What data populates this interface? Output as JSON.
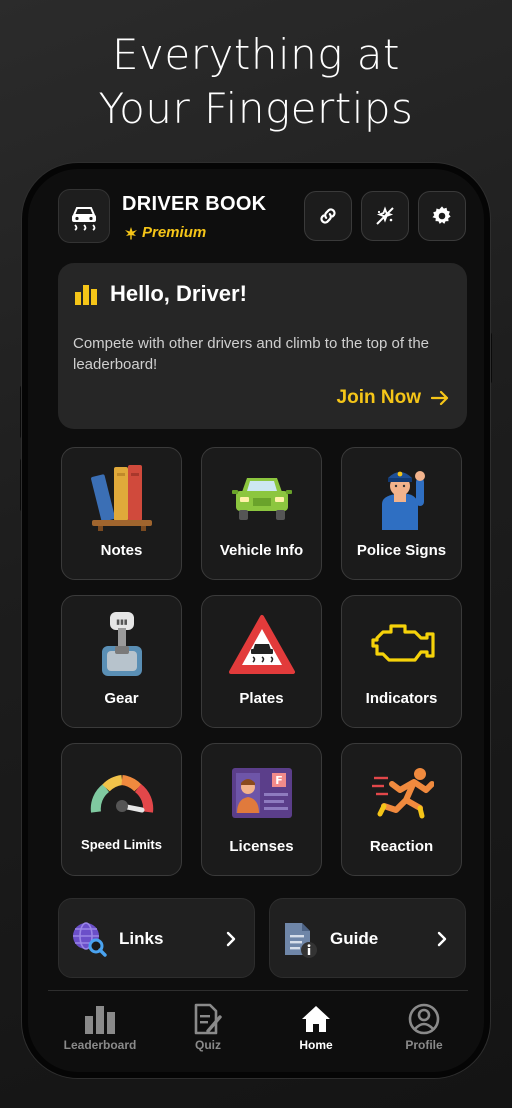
{
  "headline": {
    "line1": "Everything at",
    "line2": "Your Fingertips"
  },
  "header": {
    "title": "DRIVER BOOK",
    "badge": "Premium",
    "accent": "#f5c518"
  },
  "hello": {
    "title": "Hello, Driver!",
    "text": "Compete with other drivers and climb to the top of the leaderboard!",
    "cta": "Join Now"
  },
  "tiles": [
    {
      "label": "Notes",
      "icon": "books-icon"
    },
    {
      "label": "Vehicle Info",
      "icon": "car-icon"
    },
    {
      "label": "Police Signs",
      "icon": "police-officer-icon"
    },
    {
      "label": "Gear",
      "icon": "gear-shift-icon"
    },
    {
      "label": "Plates",
      "icon": "slippery-road-sign-icon"
    },
    {
      "label": "Indicators",
      "icon": "engine-warning-icon"
    },
    {
      "label": "Speed Limits",
      "icon": "speedometer-icon"
    },
    {
      "label": "Licenses",
      "icon": "license-card-icon"
    },
    {
      "label": "Reaction",
      "icon": "runner-icon"
    }
  ],
  "wide": [
    {
      "label": "Links",
      "icon": "globe-search-icon"
    },
    {
      "label": "Guide",
      "icon": "document-info-icon"
    }
  ],
  "nav": [
    {
      "label": "Leaderboard",
      "icon": "bar-chart-icon"
    },
    {
      "label": "Quiz",
      "icon": "quiz-icon"
    },
    {
      "label": "Home",
      "icon": "home-icon"
    },
    {
      "label": "Profile",
      "icon": "profile-icon"
    }
  ]
}
